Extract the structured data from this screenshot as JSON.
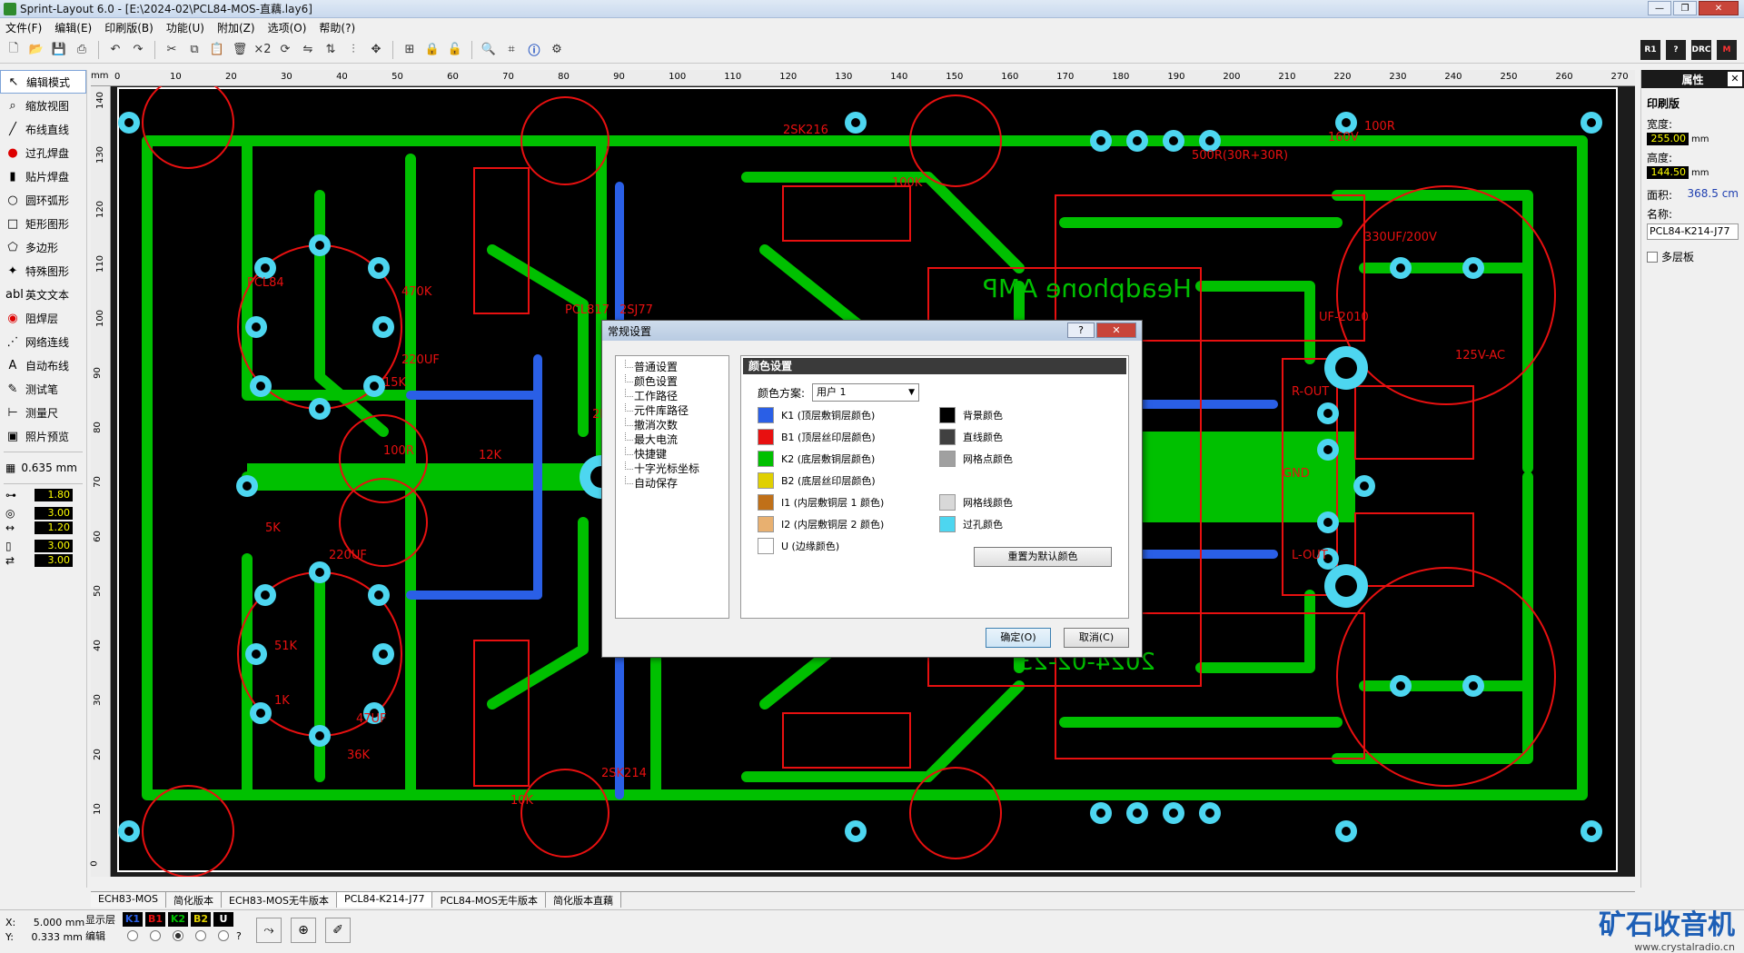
{
  "window": {
    "title": "Sprint-Layout 6.0 - [E:\\2024-02\\PCL84-MOS-直藕.lay6]"
  },
  "menu": [
    "文件(F)",
    "编辑(E)",
    "印刷版(B)",
    "功能(U)",
    "附加(Z)",
    "选项(O)",
    "帮助(?)"
  ],
  "toolbar": {
    "multiply_label": "×2",
    "right_icons": [
      "R1",
      "?",
      "DRC",
      "M"
    ]
  },
  "toolbox": {
    "tools": [
      {
        "id": "edit",
        "icon": "pointer-icon",
        "glyph": "↖",
        "label": "编辑模式",
        "active": true
      },
      {
        "id": "zoom",
        "icon": "zoom-icon",
        "glyph": "⌕",
        "label": "缩放视图"
      },
      {
        "id": "track",
        "icon": "track-icon",
        "glyph": "╱",
        "label": "布线直线"
      },
      {
        "id": "pad",
        "icon": "pad-icon",
        "glyph": "●",
        "label": "过孔焊盘"
      },
      {
        "id": "smd",
        "icon": "smd-icon",
        "glyph": "▮",
        "label": "贴片焊盘"
      },
      {
        "id": "circle",
        "icon": "circle-icon",
        "glyph": "○",
        "label": "圆环弧形"
      },
      {
        "id": "rect",
        "icon": "rect-icon",
        "glyph": "□",
        "label": "矩形图形"
      },
      {
        "id": "polygon",
        "icon": "polygon-icon",
        "glyph": "⬠",
        "label": "多边形"
      },
      {
        "id": "special",
        "icon": "special-icon",
        "glyph": "✦",
        "label": "特殊图形"
      },
      {
        "id": "text",
        "icon": "text-icon",
        "glyph": "abl",
        "label": "英文文本"
      },
      {
        "id": "mask",
        "icon": "mask-icon",
        "glyph": "◉",
        "label": "阻焊层"
      },
      {
        "id": "net",
        "icon": "net-icon",
        "glyph": "⋰",
        "label": "网络连线"
      },
      {
        "id": "autoroute",
        "icon": "autoroute-icon",
        "glyph": "A",
        "label": "自动布线"
      },
      {
        "id": "test",
        "icon": "probe-icon",
        "glyph": "✎",
        "label": "测试笔"
      },
      {
        "id": "measure",
        "icon": "ruler-icon",
        "glyph": "⊢",
        "label": "测量尺"
      },
      {
        "id": "photo",
        "icon": "photo-icon",
        "glyph": "▣",
        "label": "照片预览"
      }
    ],
    "grid_value": "0.635 mm",
    "track_width": "1.80",
    "pad_outer": "3.00",
    "pad_inner": "1.20",
    "smd_w": "3.00",
    "smd_h": "3.00"
  },
  "ruler": {
    "unit": "mm",
    "x_ticks": [
      "0",
      "10",
      "20",
      "30",
      "40",
      "50",
      "60",
      "70",
      "80",
      "90",
      "100",
      "110",
      "120",
      "130",
      "140",
      "150",
      "160",
      "170",
      "180",
      "190",
      "200",
      "210",
      "220",
      "230",
      "240",
      "250",
      "260",
      "270"
    ],
    "y_ticks": [
      "140",
      "130",
      "120",
      "110",
      "100",
      "90",
      "80",
      "70",
      "60",
      "50",
      "40",
      "30",
      "20",
      "10",
      "0"
    ]
  },
  "pcb": {
    "board_text": "Headphone AMP",
    "date_text": "2024-02-23",
    "labels": [
      "2SK216",
      "500R(30R+30R)",
      "160V",
      "100R",
      "330UF/200V",
      "UF-2010",
      "125V-AC",
      "R-OUT",
      "L-OUT",
      "GND",
      "PCL84",
      "470K",
      "220UF",
      "15K",
      "100R",
      "12K",
      "2K+/1W",
      "2SJ77",
      "PCL817",
      "2SK214",
      "47UF",
      "36K",
      "1K",
      "51K",
      "68V/1W",
      "100K",
      "220UF",
      "5K",
      "10K"
    ],
    "colors": {
      "bg": "#1c1c1c",
      "copper_bottom": "#00c000",
      "copper_top": "#2a5fe6",
      "silk": "#e81010",
      "via": "#4dd6f0",
      "outline": "#ffffff"
    }
  },
  "props": {
    "title": "属性",
    "section": "印刷版",
    "width_label": "宽度:",
    "width_value": "255.00",
    "height_label": "高度:",
    "height_value": "144.50",
    "unit": "mm",
    "area_label": "面积:",
    "area_value": "368.5 cm",
    "name_label": "名称:",
    "name_value": "PCL84-K214-J77",
    "multilayer_label": "多层板"
  },
  "tabs": [
    "ECH83-MOS",
    "简化版本",
    "ECH83-MOS无牛版本",
    "PCL84-K214-J77",
    "PCL84-MOS无牛版本",
    "简化版本直藕"
  ],
  "active_tab": 3,
  "status": {
    "x_label": "X:",
    "x_value": "5.000 mm",
    "y_label": "Y:",
    "y_value": "0.333 mm",
    "show_layer_label": "显示层",
    "edit_label": "编辑",
    "layers": [
      {
        "name": "K1",
        "color": "#2a5fe6"
      },
      {
        "name": "B1",
        "color": "#e81010"
      },
      {
        "name": "K2",
        "color": "#00c000"
      },
      {
        "name": "B2",
        "color": "#e0d000"
      },
      {
        "name": "U",
        "color": "#ffffff"
      }
    ],
    "question": "?",
    "logo_text": "矿石收音机",
    "logo_url": "www.crystalradio.cn"
  },
  "dialog": {
    "title": "常规设置",
    "help_btn": "?",
    "close_btn": "✕",
    "nav": [
      "普通设置",
      "颜色设置",
      "工作路径",
      "元件库路径",
      "撤消次数",
      "最大电流",
      "快捷键",
      "十字光标坐标",
      "自动保存"
    ],
    "nav_selected": 1,
    "panel_title": "颜色设置",
    "scheme_label": "颜色方案:",
    "scheme_value": "用户 1",
    "left_colors": [
      {
        "label": "K1 (顶层敷铜层颜色)",
        "color": "#2a5fe6"
      },
      {
        "label": "B1 (顶层丝印层颜色)",
        "color": "#e81010"
      },
      {
        "label": "K2 (底层敷铜层颜色)",
        "color": "#00c000"
      },
      {
        "label": "B2 (底层丝印层颜色)",
        "color": "#e0d000"
      },
      {
        "label": "I1 (内层敷铜层 1 颜色)",
        "color": "#c07018"
      },
      {
        "label": "I2 (内层敷铜层 2 颜色)",
        "color": "#e8b070"
      },
      {
        "label": "U (边缘颜色)",
        "color": "#ffffff"
      }
    ],
    "right_colors": [
      {
        "label": "背景颜色",
        "color": "#000000"
      },
      {
        "label": "直线颜色",
        "color": "#404040"
      },
      {
        "label": "网格点颜色",
        "color": "#a0a0a0"
      },
      {
        "label": "网格线颜色",
        "color": "#d8d8d8"
      },
      {
        "label": "过孔颜色",
        "color": "#4dd6f0"
      }
    ],
    "reset_label": "重置为默认颜色",
    "ok_label": "确定(O)",
    "cancel_label": "取消(C)"
  }
}
